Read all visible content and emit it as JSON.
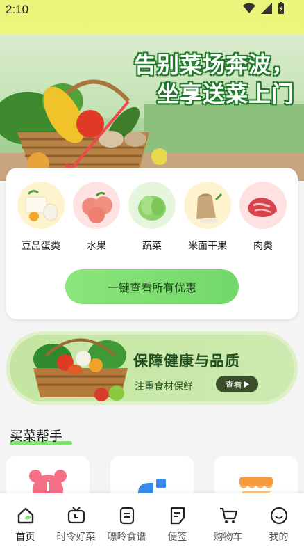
{
  "status_bar": {
    "time": "2:10"
  },
  "hero": {
    "slogan_line1": "告别菜场奔波，",
    "slogan_line2": "坐享送菜上门"
  },
  "categories": [
    {
      "label": "豆品蛋类",
      "icon": "tofu-egg-icon"
    },
    {
      "label": "水果",
      "icon": "peach-icon"
    },
    {
      "label": "蔬菜",
      "icon": "cabbage-icon"
    },
    {
      "label": "米面干果",
      "icon": "rice-sack-icon"
    },
    {
      "label": "肉类",
      "icon": "meat-icon"
    }
  ],
  "cta": {
    "label": "一键查看所有优惠"
  },
  "banner": {
    "title": "保障健康与品质",
    "subtitle": "注重食材保鲜",
    "button": "查看"
  },
  "helper": {
    "title": "买菜帮手"
  },
  "nav": [
    {
      "label": "首页",
      "icon": "home-icon",
      "active": true
    },
    {
      "label": "时令好菜",
      "icon": "tv-icon",
      "active": false
    },
    {
      "label": "嘌呤食谱",
      "icon": "list-icon",
      "active": false
    },
    {
      "label": "便签",
      "icon": "note-icon",
      "active": false
    },
    {
      "label": "购物车",
      "icon": "cart-icon",
      "active": false
    },
    {
      "label": "我的",
      "icon": "profile-icon",
      "active": false
    }
  ],
  "colors": {
    "accent_green": "#7fe56f",
    "banner_bg": "#c4e6a1",
    "status_bg": "#e9f47a",
    "arrow": "#ef4a4a"
  }
}
